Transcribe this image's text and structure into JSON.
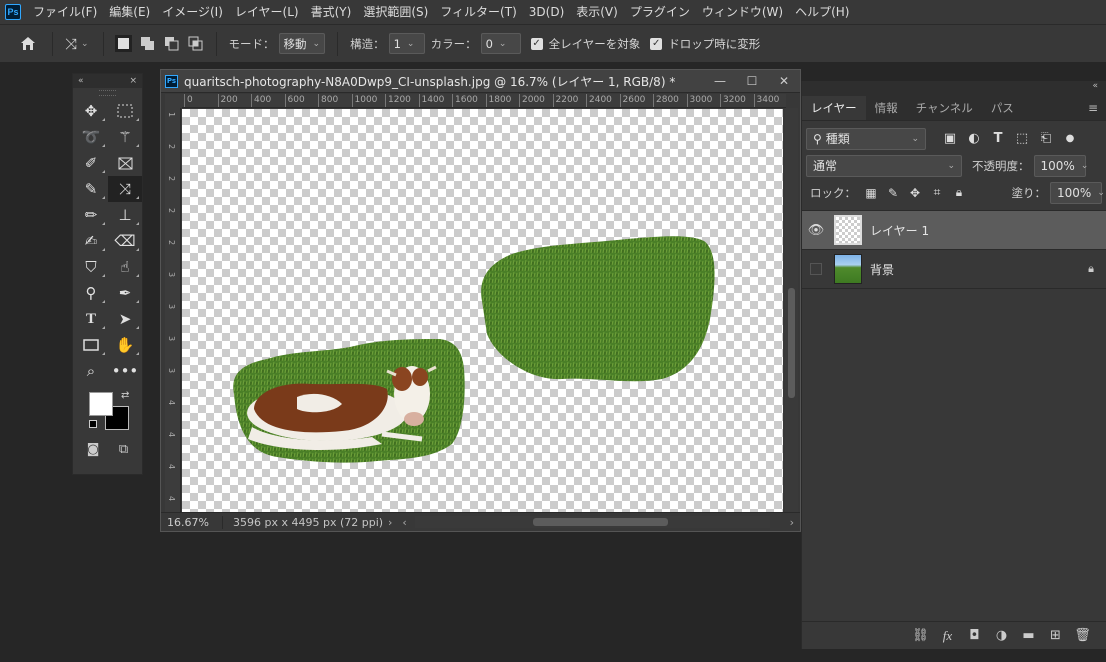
{
  "menubar": {
    "logo": "Ps",
    "items": [
      "ファイル(F)",
      "編集(E)",
      "イメージ(I)",
      "レイヤー(L)",
      "書式(Y)",
      "選択範囲(S)",
      "フィルター(T)",
      "3D(D)",
      "表示(V)",
      "プラグイン",
      "ウィンドウ(W)",
      "ヘルプ(H)"
    ]
  },
  "options": {
    "mode_label": "モード：",
    "mode_value": "移動",
    "structure_label": "構造：",
    "structure_value": "1",
    "color_label": "カラー：",
    "color_value": "0",
    "all_layers_label": "全レイヤーを対象",
    "all_layers_checked": true,
    "transform_on_drop_label": "ドロップ時に変形",
    "transform_on_drop_checked": true
  },
  "colors": {
    "foreground": "#ffffff",
    "background": "#000000",
    "accent": "#31a8ff"
  },
  "document": {
    "title": "quaritsch-photography-N8A0Dwp9_CI-unsplash.jpg @ 16.7% (レイヤー 1, RGB/8) *",
    "zoom": "16.67%",
    "size_info": "3596 px x 4495 px (72 ppi)",
    "ruler_top": [
      "0",
      "200",
      "400",
      "600",
      "800",
      "1000",
      "1200",
      "1400",
      "1600",
      "1800",
      "2000",
      "2200",
      "2400",
      "2600",
      "2800",
      "3000",
      "3200",
      "3400"
    ],
    "ruler_left": [
      "1",
      "2",
      "2",
      "2",
      "2",
      "3",
      "3",
      "3",
      "3",
      "4",
      "4",
      "4",
      "4"
    ]
  },
  "panel": {
    "tabs": [
      "レイヤー",
      "情報",
      "チャンネル",
      "パス"
    ],
    "filter_value": "種類",
    "blend_mode": "通常",
    "opacity_label": "不透明度：",
    "opacity_value": "100%",
    "lock_label": "ロック：",
    "fill_label": "塗り：",
    "fill_value": "100%",
    "layers": [
      {
        "name": "レイヤー 1",
        "visible": true,
        "selected": true,
        "locked": false
      },
      {
        "name": "背景",
        "visible": false,
        "selected": false,
        "locked": true
      }
    ]
  }
}
